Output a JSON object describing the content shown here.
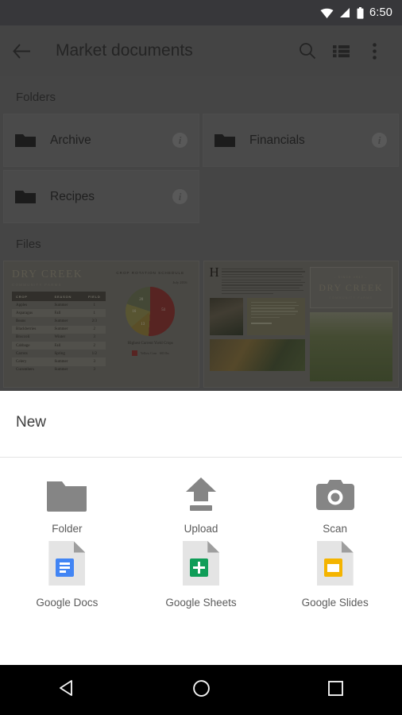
{
  "status_bar": {
    "time": "6:50",
    "icons": [
      "wifi-icon",
      "signal-icon",
      "battery-icon"
    ]
  },
  "app_bar": {
    "title": "Market documents",
    "back_label": "Back",
    "search_label": "Search",
    "view_label": "List view",
    "overflow_label": "More options"
  },
  "sections": {
    "folders_label": "Folders",
    "files_label": "Files"
  },
  "folders": [
    {
      "name": "Archive",
      "info": "i"
    },
    {
      "name": "Financials",
      "info": "i"
    },
    {
      "name": "Recipes",
      "info": "i"
    }
  ],
  "files": [
    {
      "brand": "DRY CREEK",
      "sub": "COMMUNITY FARMS",
      "chart_title": "CROP ROTATION SCHEDULE",
      "chart_date": "July 2016",
      "caption": "Highest Current Yield Crops",
      "legend_label": "Yellow Corn",
      "legend_value": "603 lbs",
      "columns": [
        "CROP",
        "SEASON",
        "FIELD"
      ],
      "rows": [
        [
          "Apples",
          "Summer",
          "1"
        ],
        [
          "Asparagus",
          "Fall",
          "1"
        ],
        [
          "Beans",
          "Summer",
          "2/3"
        ],
        [
          "Blackberries",
          "Summer",
          "2"
        ],
        [
          "Broccoli",
          "Winter",
          "3"
        ],
        [
          "Cabbage",
          "Fall",
          "2"
        ],
        [
          "Carrots",
          "Spring",
          "1/2"
        ],
        [
          "Celery",
          "Summer",
          "3"
        ],
        [
          "Cucumbers",
          "Summer",
          "3"
        ]
      ]
    },
    {
      "since": "- SINCE 1947 -",
      "brand": "DRY CREEK",
      "sub": "COMMUNITY FARMS",
      "drop_cap": "H",
      "photos": [
        "farmer-portrait",
        "harvest-vegetables",
        "vineyard-field"
      ]
    }
  ],
  "chart_data": {
    "type": "pie",
    "title": "CROP ROTATION SCHEDULE",
    "subtitle": "July 2016",
    "categories": [
      "51",
      "13",
      "16",
      "20"
    ],
    "values": [
      51,
      13,
      16,
      20
    ],
    "colors": [
      "#8d3a38",
      "#917f3f",
      "#8e8a52",
      "#6e7557"
    ],
    "legend": [
      {
        "name": "Yellow Corn",
        "value": "603 lbs",
        "color": "#8d3a38"
      }
    ],
    "annotation": "Highest Current Yield Crops",
    "legend_position": "bottom"
  },
  "sheet": {
    "title": "New",
    "options": [
      {
        "label": "Folder",
        "icon": "folder-icon"
      },
      {
        "label": "Upload",
        "icon": "upload-icon"
      },
      {
        "label": "Scan",
        "icon": "camera-icon"
      },
      {
        "label": "Google Docs",
        "icon": "google-docs-icon",
        "color": "#4285f4"
      },
      {
        "label": "Google Sheets",
        "icon": "google-sheets-icon",
        "color": "#0f9d58"
      },
      {
        "label": "Google Slides",
        "icon": "google-slides-icon",
        "color": "#f4b400"
      }
    ]
  },
  "nav_bar": {
    "back": "back-triangle-icon",
    "home": "home-circle-icon",
    "recents": "recents-square-icon"
  }
}
